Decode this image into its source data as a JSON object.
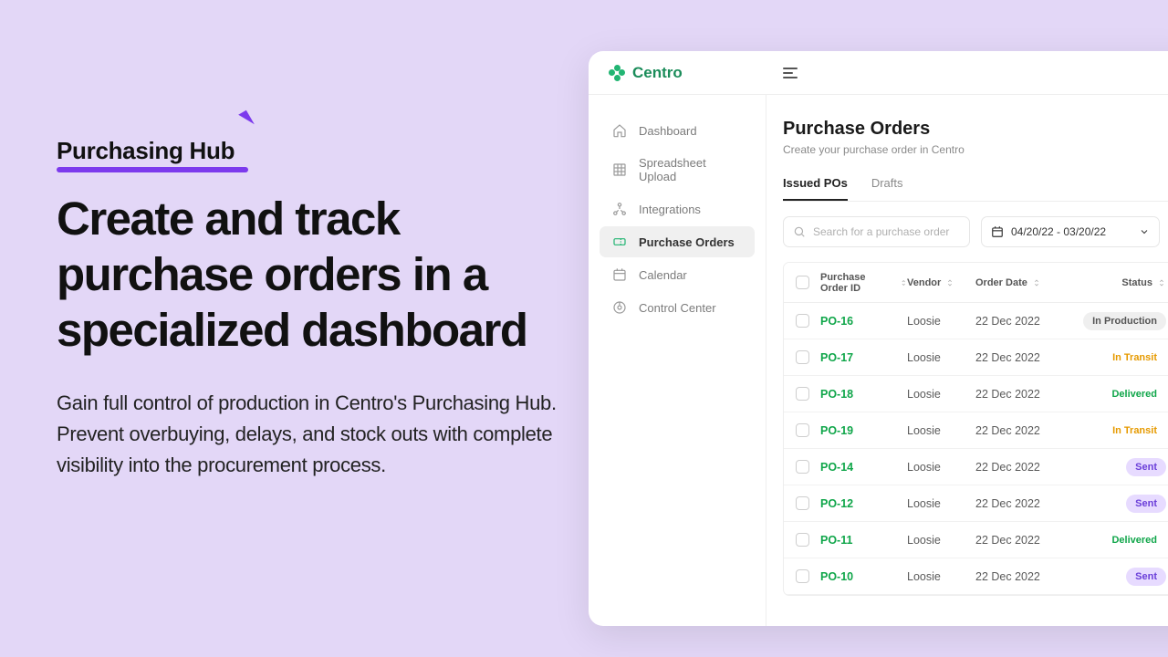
{
  "landing": {
    "badge": "Purchasing Hub",
    "headline": "Create and track purchase orders in a specialized dashboard",
    "subtext": "Gain full control of production in Centro's Purchasing Hub. Prevent overbuying, delays, and stock outs with complete visibility into the procurement process."
  },
  "brand": {
    "name": "Centro"
  },
  "sidebar": {
    "items": [
      {
        "icon": "home",
        "label": "Dashboard",
        "active": false
      },
      {
        "icon": "grid",
        "label": "Spreadsheet Upload",
        "active": false
      },
      {
        "icon": "int",
        "label": "Integrations",
        "active": false
      },
      {
        "icon": "ticket",
        "label": "Purchase Orders",
        "active": true
      },
      {
        "icon": "cal",
        "label": "Calendar",
        "active": false
      },
      {
        "icon": "ctrl",
        "label": "Control Center",
        "active": false
      }
    ]
  },
  "page": {
    "title": "Purchase Orders",
    "subtitle": "Create your purchase order in Centro",
    "tabs": [
      {
        "label": "Issued POs",
        "active": true
      },
      {
        "label": "Drafts",
        "active": false
      }
    ],
    "search_placeholder": "Search for a purchase order",
    "daterange": "04/20/22 - 03/20/22"
  },
  "table": {
    "columns": [
      "Purchase Order ID",
      "Vendor",
      "Order Date",
      "Status"
    ],
    "rows": [
      {
        "id": "PO-16",
        "vendor": "Loosie",
        "date": "22 Dec 2022",
        "status": "In Production",
        "status_kind": "production"
      },
      {
        "id": "PO-17",
        "vendor": "Loosie",
        "date": "22 Dec 2022",
        "status": "In Transit",
        "status_kind": "transit"
      },
      {
        "id": "PO-18",
        "vendor": "Loosie",
        "date": "22 Dec 2022",
        "status": "Delivered",
        "status_kind": "delivered"
      },
      {
        "id": "PO-19",
        "vendor": "Loosie",
        "date": "22 Dec 2022",
        "status": "In Transit",
        "status_kind": "transit"
      },
      {
        "id": "PO-14",
        "vendor": "Loosie",
        "date": "22 Dec 2022",
        "status": "Sent",
        "status_kind": "sent"
      },
      {
        "id": "PO-12",
        "vendor": "Loosie",
        "date": "22 Dec 2022",
        "status": "Sent",
        "status_kind": "sent"
      },
      {
        "id": "PO-11",
        "vendor": "Loosie",
        "date": "22 Dec 2022",
        "status": "Delivered",
        "status_kind": "delivered"
      },
      {
        "id": "PO-10",
        "vendor": "Loosie",
        "date": "22 Dec 2022",
        "status": "Sent",
        "status_kind": "sent"
      }
    ]
  }
}
